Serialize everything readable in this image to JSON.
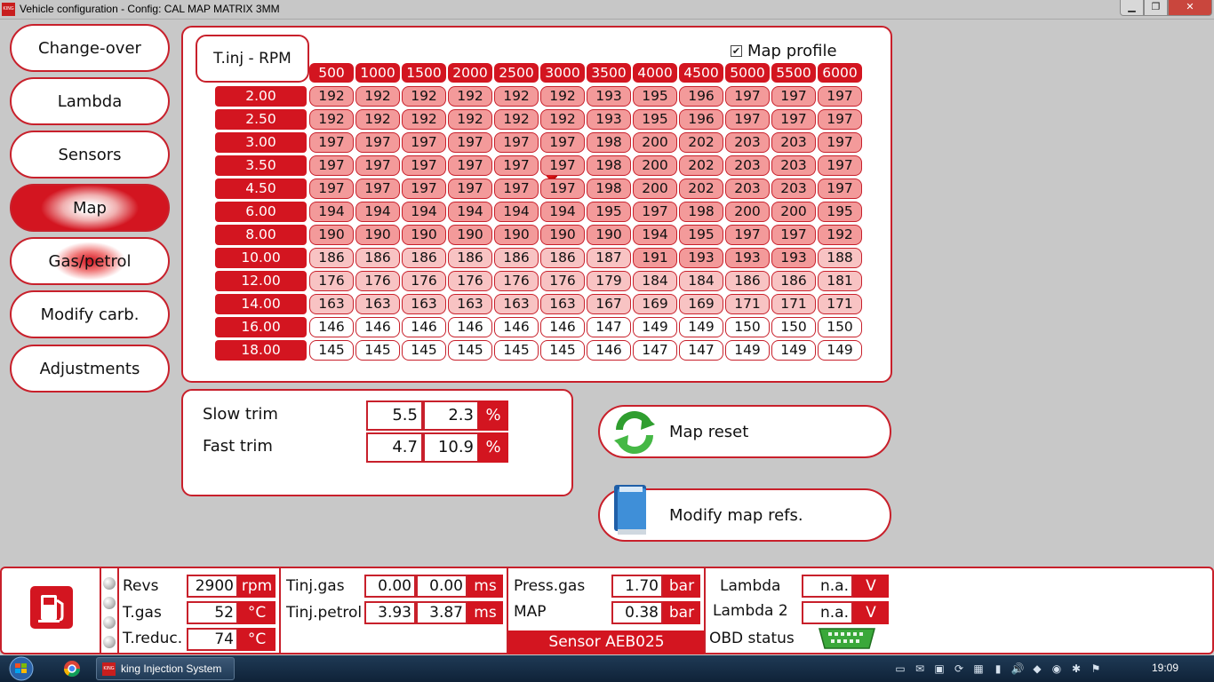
{
  "window": {
    "title": "Vehicle configuration - Config: CAL MAP MATRIX 3MM",
    "app_icon_text": "KING",
    "minimize": "▁",
    "maximize": "❐",
    "close": "✕"
  },
  "menu": [
    {
      "label": "Change-over",
      "state": "normal"
    },
    {
      "label": "Lambda",
      "state": "normal"
    },
    {
      "label": "Sensors",
      "state": "normal"
    },
    {
      "label": "Map",
      "state": "active"
    },
    {
      "label": "Gas/petrol",
      "state": "gas"
    },
    {
      "label": "Modify carb.",
      "state": "normal"
    },
    {
      "label": "Adjustments",
      "state": "normal"
    }
  ],
  "map": {
    "title": "T.inj - RPM",
    "profile_label": "Map profile",
    "profile_checked": true,
    "check_glyph": "✔",
    "cols": [
      "500",
      "1000",
      "1500",
      "2000",
      "2500",
      "3000",
      "3500",
      "4000",
      "4500",
      "5000",
      "5500",
      "6000"
    ],
    "rows": [
      {
        "label": "2.00",
        "values": [
          192,
          192,
          192,
          192,
          192,
          192,
          193,
          195,
          196,
          197,
          197,
          197
        ]
      },
      {
        "label": "2.50",
        "values": [
          192,
          192,
          192,
          192,
          192,
          192,
          193,
          195,
          196,
          197,
          197,
          197
        ]
      },
      {
        "label": "3.00",
        "values": [
          197,
          197,
          197,
          197,
          197,
          197,
          198,
          200,
          202,
          203,
          203,
          197
        ]
      },
      {
        "label": "3.50",
        "values": [
          197,
          197,
          197,
          197,
          197,
          197,
          198,
          200,
          202,
          203,
          203,
          197
        ]
      },
      {
        "label": "4.50",
        "values": [
          197,
          197,
          197,
          197,
          197,
          197,
          198,
          200,
          202,
          203,
          203,
          197
        ]
      },
      {
        "label": "6.00",
        "values": [
          194,
          194,
          194,
          194,
          194,
          194,
          195,
          197,
          198,
          200,
          200,
          195
        ]
      },
      {
        "label": "8.00",
        "values": [
          190,
          190,
          190,
          190,
          190,
          190,
          190,
          194,
          195,
          197,
          197,
          192
        ]
      },
      {
        "label": "10.00",
        "values": [
          186,
          186,
          186,
          186,
          186,
          186,
          187,
          191,
          193,
          193,
          193,
          188
        ]
      },
      {
        "label": "12.00",
        "values": [
          176,
          176,
          176,
          176,
          176,
          176,
          179,
          184,
          184,
          186,
          186,
          181
        ]
      },
      {
        "label": "14.00",
        "values": [
          163,
          163,
          163,
          163,
          163,
          163,
          167,
          169,
          169,
          171,
          171,
          171
        ]
      },
      {
        "label": "16.00",
        "values": [
          146,
          146,
          146,
          146,
          146,
          146,
          147,
          149,
          149,
          150,
          150,
          150
        ]
      },
      {
        "label": "18.00",
        "values": [
          145,
          145,
          145,
          145,
          145,
          145,
          146,
          147,
          147,
          149,
          149,
          149
        ]
      }
    ],
    "colors": {
      "hot": "#f39a9a",
      "warm": "#f8c3c3",
      "cool": "#ffffff",
      "accent": "#d31520"
    }
  },
  "trim": {
    "slow_label": "Slow trim",
    "slow_a": "5.5",
    "slow_b": "2.3",
    "fast_label": "Fast trim",
    "fast_a": "4.7",
    "fast_b": "10.9",
    "unit": "%"
  },
  "actions": {
    "reset_label": "Map reset",
    "modify_label": "Modify map refs."
  },
  "status": {
    "revs_label": "Revs",
    "revs_value": "2900",
    "revs_unit": "rpm",
    "tgas_label": "T.gas",
    "tgas_value": "52",
    "tgas_unit": "°C",
    "treduc_label": "T.reduc.",
    "treduc_value": "74",
    "treduc_unit": "°C",
    "tinj_gas_label": "Tinj.gas",
    "tinj_gas_a": "0.00",
    "tinj_gas_b": "0.00",
    "tinj_gas_unit": "ms",
    "tinj_petrol_label": "Tinj.petrol",
    "tinj_petrol_a": "3.93",
    "tinj_petrol_b": "3.87",
    "tinj_petrol_unit": "ms",
    "press_gas_label": "Press.gas",
    "press_gas_value": "1.70",
    "press_gas_unit": "bar",
    "map_label": "MAP",
    "map_value": "0.38",
    "map_unit": "bar",
    "sensor_label": "Sensor AEB025",
    "lambda_label": "Lambda",
    "lambda_value": "n.a.",
    "lambda_unit": "V",
    "lambda2_label": "Lambda 2",
    "lambda2_value": "n.a.",
    "lambda2_unit": "V",
    "obd_label": "OBD status"
  },
  "taskbar": {
    "app_label": "king Injection System",
    "app_icon_text": "KING",
    "clock": "19:09",
    "tray": [
      "▭",
      "✉",
      "▣",
      "⟳",
      "▦",
      "▮",
      "🔊",
      "◆",
      "◉",
      "✱",
      "⚑"
    ]
  }
}
